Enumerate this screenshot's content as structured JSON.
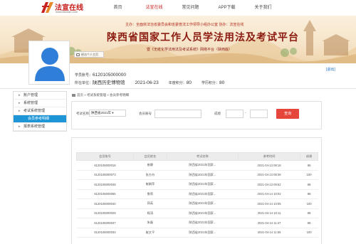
{
  "site": {
    "logo_cn": "法宣在线",
    "logo_en": "www.ifaxuan.com"
  },
  "nav": {
    "items": [
      "首页",
      "法宣在线",
      "常见问题",
      "APP下载",
      "关于我们"
    ],
    "active_index": 1
  },
  "banner": {
    "host_line": "主办：全面依法治省委员会和省委普法工作领导小组办公室    协办：法宣在线",
    "title": "陕西省国家工作人员学法用法及考试平台",
    "subtitle": "暨《无纸化学法用法及考试系统》网络平台（陕西版）"
  },
  "profile": {
    "upload_label": "经访个人主页",
    "exit_label": "[退出]",
    "learner_no_label": "学员账号：",
    "learner_no": "6120105000000",
    "unit_label": "所在单位：",
    "unit": "陕西历史博物馆",
    "date": "2021-06-23",
    "year_points_label": "年度积分：",
    "year_points": "80",
    "study_points_label": "学历积分：",
    "study_points": "80"
  },
  "sidebar": {
    "items": [
      {
        "label": "账户管理",
        "level": 1
      },
      {
        "label": "系统管理",
        "level": 1
      },
      {
        "label": "考试系统管理",
        "level": 1
      },
      {
        "label": "会员参考明细",
        "level": 2,
        "active": true
      },
      {
        "label": "报表系统管理",
        "level": 1
      }
    ]
  },
  "breadcrumb": "首页 » 考试系统管理 » 会员参考明细",
  "filter": {
    "exam_label": "考试名称：",
    "exam_value": "陕西省2021年 ▾",
    "member_label": "会员账号",
    "member_placeholder": "",
    "score_label": "成绩",
    "score_sep": "-",
    "search_label": "查询"
  },
  "table": {
    "headers": [
      "会员账号",
      "会员姓名",
      "考试名称",
      "参考时间",
      "成绩"
    ],
    "rows": [
      [
        "6120105000018",
        "崔静",
        "陕西省2021年国家...",
        "2021-04-13 08:18",
        "95"
      ],
      [
        "6120105000073",
        "张方舟",
        "陕西省2021年国家...",
        "2021-04-13 08:38",
        "100"
      ],
      [
        "6120105000049",
        "崔娟萍",
        "陕西省2021年国家...",
        "2021-04-13 09:52",
        "98"
      ],
      [
        "6120105000055",
        "詹莉",
        "陕西省2021年国家...",
        "2021-04-14 10:02",
        "98"
      ],
      [
        "6120105000040",
        "郭英",
        "陕西省2021年国家...",
        "2021-04-14 10:05",
        "100"
      ],
      [
        "6120105000029",
        "杨涛",
        "陕西省2021年国家...",
        "2021-04-14 10:11",
        "98"
      ],
      [
        "6120105000037",
        "朱磊",
        "陕西省2021年国家...",
        "2021-04-14 11:47",
        "98"
      ],
      [
        "6120105000033",
        "崔文平",
        "陕西省2021年国家...",
        "2021-04-14 11:55",
        "100"
      ]
    ]
  },
  "colors": {
    "brand_red": "#c8201e",
    "accent_blue": "#1e95d6",
    "button_red": "#e6453c"
  }
}
